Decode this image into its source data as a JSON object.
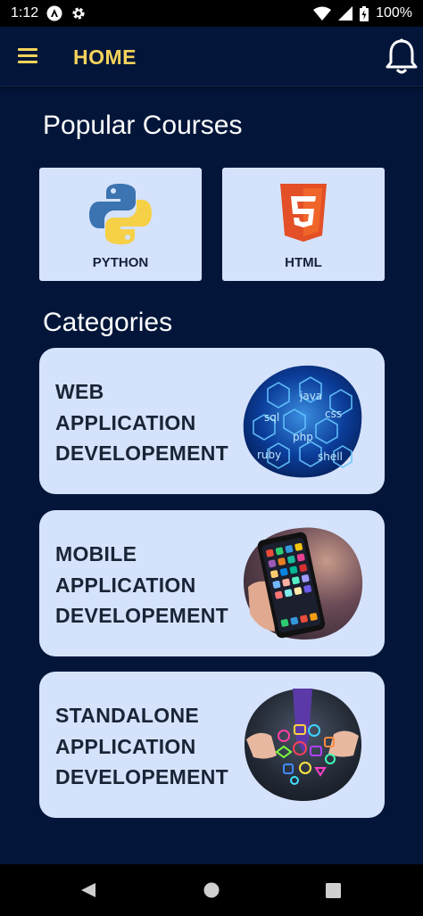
{
  "status": {
    "time": "1:12",
    "battery": "100%"
  },
  "app_bar": {
    "title": "HOME"
  },
  "popular": {
    "title": "Popular Courses",
    "courses": [
      {
        "label": "PYTHON"
      },
      {
        "label": "HTML"
      }
    ]
  },
  "categories": {
    "title": "Categories",
    "items": [
      {
        "line1": "WEB",
        "line2": "APPLICATION",
        "line3": "DEVELOPEMENT"
      },
      {
        "line1": "MOBILE",
        "line2": "APPLICATION",
        "line3": "DEVELOPEMENT"
      },
      {
        "line1": "STANDALONE",
        "line2": "APPLICATION",
        "line3": "DEVELOPEMENT"
      }
    ]
  },
  "colors": {
    "background": "#03163a",
    "accent": "#f5d35a",
    "card": "#d5e2fb"
  },
  "icons": [
    "menu-icon",
    "bell-icon",
    "python-logo",
    "html5-logo",
    "back-icon",
    "home-icon",
    "recents-icon"
  ]
}
